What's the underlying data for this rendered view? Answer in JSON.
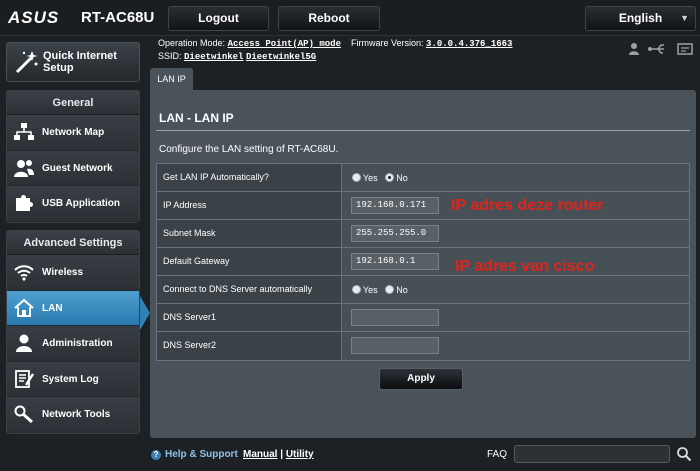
{
  "header": {
    "brand": "ASUS",
    "model": "RT-AC68U",
    "logout_label": "Logout",
    "reboot_label": "Reboot",
    "language": "English",
    "op_mode_label": "Operation Mode:",
    "op_mode_value": "Access Point(AP) mode",
    "firmware_label": "Firmware Version:",
    "firmware_value": "3.0.0.4.376_1663",
    "ssid_label": "SSID:",
    "ssid_1": "Dieetwinkel",
    "ssid_2": "Dieetwinkel5G"
  },
  "sidebar": {
    "quick_setup": "Quick Internet Setup",
    "general_title": "General",
    "general_items": [
      {
        "label": "Network Map",
        "icon": "network-map-icon"
      },
      {
        "label": "Guest Network",
        "icon": "guest-network-icon"
      },
      {
        "label": "USB Application",
        "icon": "puzzle-icon"
      }
    ],
    "advanced_title": "Advanced Settings",
    "advanced_items": [
      {
        "label": "Wireless",
        "icon": "wifi-icon"
      },
      {
        "label": "LAN",
        "icon": "home-icon",
        "active": true
      },
      {
        "label": "Administration",
        "icon": "user-icon"
      },
      {
        "label": "System Log",
        "icon": "log-icon"
      },
      {
        "label": "Network Tools",
        "icon": "tools-icon"
      }
    ]
  },
  "main": {
    "tab": "LAN IP",
    "title": "LAN - LAN IP",
    "description": "Configure the LAN setting of RT-AC68U.",
    "rows": {
      "get_ip_auto": {
        "label": "Get LAN IP Automatically?",
        "yes": "Yes",
        "no": "No",
        "selected": "No"
      },
      "ip_address": {
        "label": "IP Address",
        "value": "192.168.0.171"
      },
      "subnet_mask": {
        "label": "Subnet Mask",
        "value": "255.255.255.0"
      },
      "default_gateway": {
        "label": "Default Gateway",
        "value": "192.168.0.1"
      },
      "dns_auto": {
        "label": "Connect to DNS Server automatically",
        "yes": "Yes",
        "no": "No",
        "selected": "none"
      },
      "dns1": {
        "label": "DNS Server1",
        "value": ""
      },
      "dns2": {
        "label": "DNS Server2",
        "value": ""
      }
    },
    "apply_label": "Apply",
    "annotations": {
      "note_router": "IP adres deze router",
      "note_cisco": "IP adres van cisco"
    }
  },
  "footer": {
    "help": "Help & Support",
    "manual": "Manual",
    "separator": "|",
    "utility": "Utility",
    "faq": "FAQ"
  },
  "colors": {
    "accent": "#2a7ab0",
    "annotation": "#e2231a",
    "panel": "#4a535a"
  }
}
